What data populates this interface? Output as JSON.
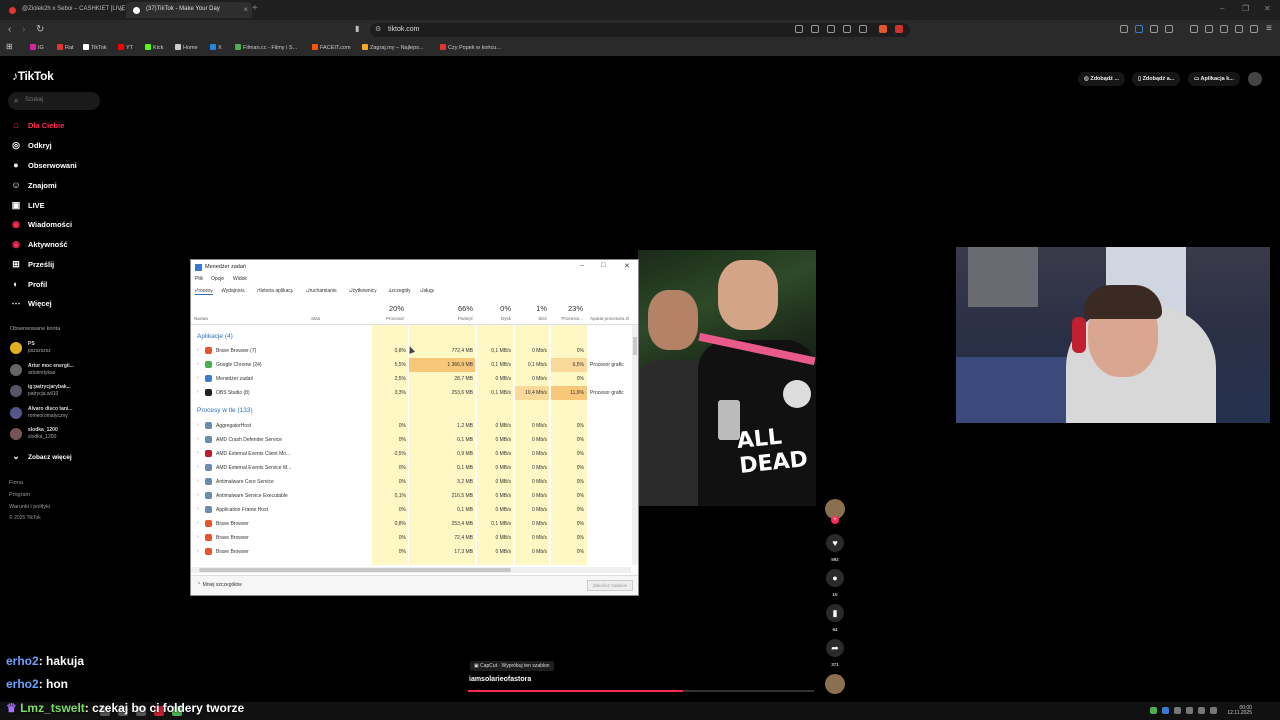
{
  "browser": {
    "tabs": [
      {
        "title": "@Ziolek2h x Seboi – CASHKIET [LIVE",
        "color": "#e3342f"
      },
      {
        "title": "(37)TikTok - Make Your Day",
        "color": "#ffffff"
      }
    ],
    "url": "tiktok.com",
    "bookmarks": [
      {
        "label": "IG",
        "color": "#d6249f"
      },
      {
        "label": "Rat",
        "color": "#e3342f"
      },
      {
        "label": "TikTok",
        "color": "#ffffff"
      },
      {
        "label": "YT",
        "color": "#ff0000"
      },
      {
        "label": "Kick",
        "color": "#53fc18"
      },
      {
        "label": "Home",
        "color": "#cccccc"
      },
      {
        "label": "X",
        "color": "#1e88e5"
      },
      {
        "label": "Filman.cc - Filmy i S...",
        "color": "#4caf50"
      },
      {
        "label": "FACEIT.com",
        "color": "#ff5500"
      },
      {
        "label": "Zagraj.my – Najleps...",
        "color": "#f9a825"
      },
      {
        "label": "Czy Popek w końcu...",
        "color": "#e3342f"
      }
    ]
  },
  "tiktok": {
    "logo": "TikTok",
    "search_placeholder": "Szukaj",
    "nav": [
      {
        "label": "Dla Ciebie",
        "icon": "home-icon",
        "active": true
      },
      {
        "label": "Odkryj",
        "icon": "compass-icon"
      },
      {
        "label": "Obserwowani",
        "icon": "following-icon"
      },
      {
        "label": "Znajomi",
        "icon": "friends-icon"
      },
      {
        "label": "LIVE",
        "icon": "live-icon"
      },
      {
        "label": "Wiadomości",
        "icon": "messages-icon"
      },
      {
        "label": "Aktywność",
        "icon": "activity-icon"
      },
      {
        "label": "Prześlij",
        "icon": "upload-icon"
      },
      {
        "label": "Profil",
        "icon": "profile-icon"
      },
      {
        "label": "Więcej",
        "icon": "more-icon"
      }
    ],
    "followed_header": "Obserwowane konta",
    "followed": [
      {
        "name": "PS",
        "user": "pszszszsz"
      },
      {
        "name": "Artur moc energii...",
        "user": "arturindykas"
      },
      {
        "name": "ig:patrycjarybak...",
        "user": "patrycja.wil10"
      },
      {
        "name": "Alvaro disco tani...",
        "user": "romeoromatyczny"
      },
      {
        "name": "slodka_1200",
        "user": "slodka_1200"
      }
    ],
    "see_more": "Zobacz więcej",
    "footer": [
      "Firma",
      "Program",
      "Warunki i polityki",
      "© 2025 TikTok"
    ],
    "header_buttons": [
      "Zdobądź ...",
      "Zdobądź a...",
      "Aplikacja k..."
    ],
    "actions": {
      "likes": "592",
      "comments": "10",
      "saves": "64",
      "shares": "371"
    },
    "capcut": "CapCut · Wypróbuj ten szablon",
    "author": "iamsolarieofastora",
    "progress": 0.62
  },
  "taskmgr": {
    "title": "Menedżer zadań",
    "menu": [
      "Plik",
      "Opcje",
      "Widok"
    ],
    "tabs": [
      "Procesy",
      "Wydajność",
      "Historia aplikacji",
      "Uruchamianie",
      "Użytkownicy",
      "Szczegóły",
      "Usługi"
    ],
    "columns": {
      "name": "Nazwa",
      "status": "Stan",
      "cpu": "Procesor",
      "mem": "Pamięć",
      "disk": "Dysk",
      "net": "Sieć",
      "gpu": "Procesor...",
      "gpu_engine": "Aparat procesora G"
    },
    "totals": {
      "cpu": "20%",
      "mem": "66%",
      "disk": "0%",
      "net": "1%",
      "gpu": "23%"
    },
    "apps_header": "Aplikacje (4)",
    "apps": [
      {
        "name": "Brave Browser (7)",
        "cpu": "0,8%",
        "mem": "772,4 MB",
        "disk": "0,1 MB/s",
        "net": "0 Mb/s",
        "gpu": "0%",
        "engine": "",
        "icon": "#e8542a"
      },
      {
        "name": "Google Chrome (24)",
        "cpu": "5,5%",
        "mem": "1 366,9 MB",
        "disk": "0,1 MB/s",
        "net": "0,1 Mb/s",
        "gpu": "6,5%",
        "engine": "Procesor grafic",
        "icon": "#4caf50"
      },
      {
        "name": "Menedżer zadań",
        "cpu": "2,5%",
        "mem": "28,7 MB",
        "disk": "0 MB/s",
        "net": "0 Mb/s",
        "gpu": "0%",
        "engine": "",
        "icon": "#3a7bd5"
      },
      {
        "name": "OBS Studio (8)",
        "cpu": "3,3%",
        "mem": "253,6 MB",
        "disk": "0,1 MB/s",
        "net": "10,4 Mb/s",
        "gpu": "11,6%",
        "engine": "Procesor grafic",
        "icon": "#222222"
      }
    ],
    "bg_header": "Procesy w tle (133)",
    "bg": [
      {
        "name": "AggregatorHost",
        "cpu": "0%",
        "mem": "1,2 MB",
        "disk": "0 MB/s",
        "net": "0 Mb/s",
        "gpu": "0%",
        "icon": "#6a8caf"
      },
      {
        "name": "AMD Crash Defender Service",
        "cpu": "0%",
        "mem": "0,1 MB",
        "disk": "0 MB/s",
        "net": "0 Mb/s",
        "gpu": "0%",
        "icon": "#6a8caf"
      },
      {
        "name": "AMD External Events Client Mo...",
        "cpu": "0,5%",
        "mem": "0,9 MB",
        "disk": "0 MB/s",
        "net": "0 Mb/s",
        "gpu": "0%",
        "icon": "#c0192c"
      },
      {
        "name": "AMD External Events Service M...",
        "cpu": "0%",
        "mem": "0,1 MB",
        "disk": "0 MB/s",
        "net": "0 Mb/s",
        "gpu": "0%",
        "icon": "#6a8caf"
      },
      {
        "name": "Antimalware Core Service",
        "cpu": "0%",
        "mem": "3,2 MB",
        "disk": "0 MB/s",
        "net": "0 Mb/s",
        "gpu": "0%",
        "icon": "#6a8caf"
      },
      {
        "name": "Antimalware Service Executable",
        "cpu": "0,1%",
        "mem": "216,5 MB",
        "disk": "0 MB/s",
        "net": "0 Mb/s",
        "gpu": "0%",
        "icon": "#6a8caf"
      },
      {
        "name": "Application Frame Host",
        "cpu": "0%",
        "mem": "0,1 MB",
        "disk": "0 MB/s",
        "net": "0 Mb/s",
        "gpu": "0%",
        "icon": "#6a8caf"
      },
      {
        "name": "Brave Browser",
        "cpu": "0,8%",
        "mem": "253,4 MB",
        "disk": "0,1 MB/s",
        "net": "0 Mb/s",
        "gpu": "0%",
        "icon": "#e8542a"
      },
      {
        "name": "Brave Browser",
        "cpu": "0%",
        "mem": "72,4 MB",
        "disk": "0 MB/s",
        "net": "0 Mb/s",
        "gpu": "0%",
        "icon": "#e8542a"
      },
      {
        "name": "Brave Browser",
        "cpu": "0%",
        "mem": "17,3 MB",
        "disk": "0 MB/s",
        "net": "0 Mb/s",
        "gpu": "0%",
        "icon": "#e8542a"
      }
    ],
    "less_details": "Mniej szczegółów",
    "end_task": "Zakończ zadanie"
  },
  "chat": [
    {
      "user": "erho2",
      "msg": ": hakuja",
      "color": "#6aa0ff"
    },
    {
      "user": "erho2",
      "msg": ": hon",
      "color": "#6aa0ff"
    },
    {
      "user": "Lmz_tswelt",
      "msg": ": czekaj bo ci foldery tworze",
      "color": "#7ddc6a"
    }
  ],
  "clock": {
    "time": "00:00",
    "date": "12.11.2025"
  },
  "video_print": "ALL DEAD"
}
